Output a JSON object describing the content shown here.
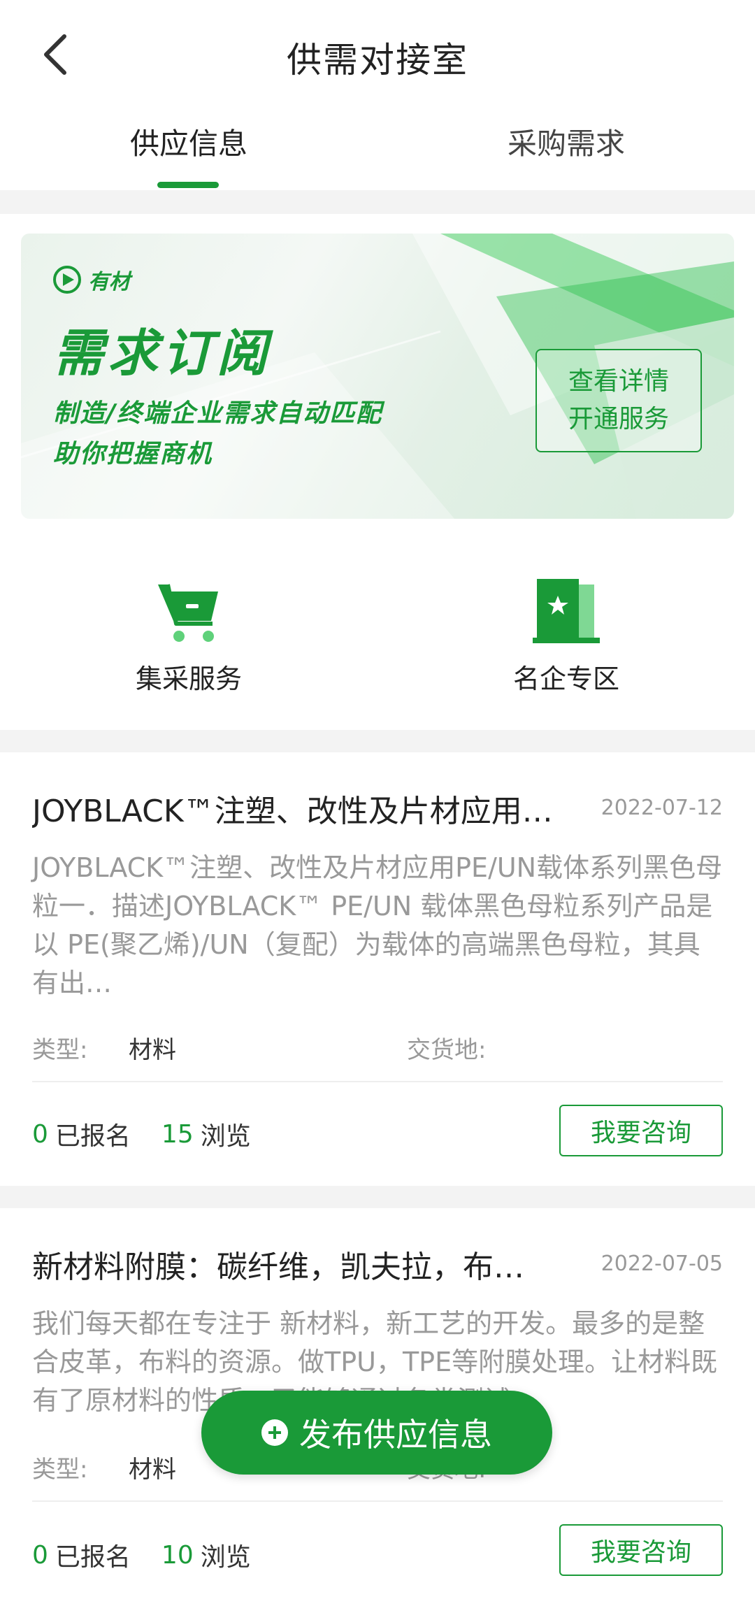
{
  "header": {
    "title": "供需对接室"
  },
  "tabs": [
    {
      "label": "供应信息",
      "active": true
    },
    {
      "label": "采购需求",
      "active": false
    }
  ],
  "banner": {
    "brand": "有材",
    "title": "需求订阅",
    "line1": "制造/终端企业需求自动匹配",
    "line2": "助你把握商机",
    "cta_line1": "查看详情",
    "cta_line2": "开通服务"
  },
  "quick_entries": [
    {
      "label": "集采服务",
      "icon": "cart-icon"
    },
    {
      "label": "名企专区",
      "icon": "building-star-icon"
    }
  ],
  "listings": [
    {
      "title": "JOYBLACK™注塑、改性及片材应用…",
      "date": "2022-07-12",
      "description": "JOYBLACK™注塑、改性及片材应用PE/UN载体系列黑色母粒一．描述JOYBLACK™ PE/UN 载体黑色母粒系列产品是以 PE(聚乙烯)/UN（复配）为载体的高端黑色母粒，其具有出…",
      "type_label": "类型:",
      "type_value": "材料",
      "delivery_label": "交货地:",
      "delivery_value": "",
      "signup_count": "0",
      "signup_label": "已报名",
      "view_count": "15",
      "view_label": "浏览",
      "consult_label": "我要咨询"
    },
    {
      "title": "新材料附膜：碳纤维，凯夫拉，布…",
      "date": "2022-07-05",
      "description": "我们每天都在专注于 新材料，新工艺的开发。最多的是整合皮革，布料的资源。做TPU，TPE等附膜处理。让材料既有了原材料的性质，又能够通过各类测试",
      "type_label": "类型:",
      "type_value": "材料",
      "delivery_label": "交货地:",
      "delivery_value": "",
      "signup_count": "0",
      "signup_label": "已报名",
      "view_count": "10",
      "view_label": "浏览",
      "consult_label": "我要咨询"
    }
  ],
  "publish_button": {
    "label": "发布供应信息"
  },
  "colors": {
    "accent": "#1a9a38",
    "muted_text": "#999999",
    "divider": "#f3f3f3"
  }
}
